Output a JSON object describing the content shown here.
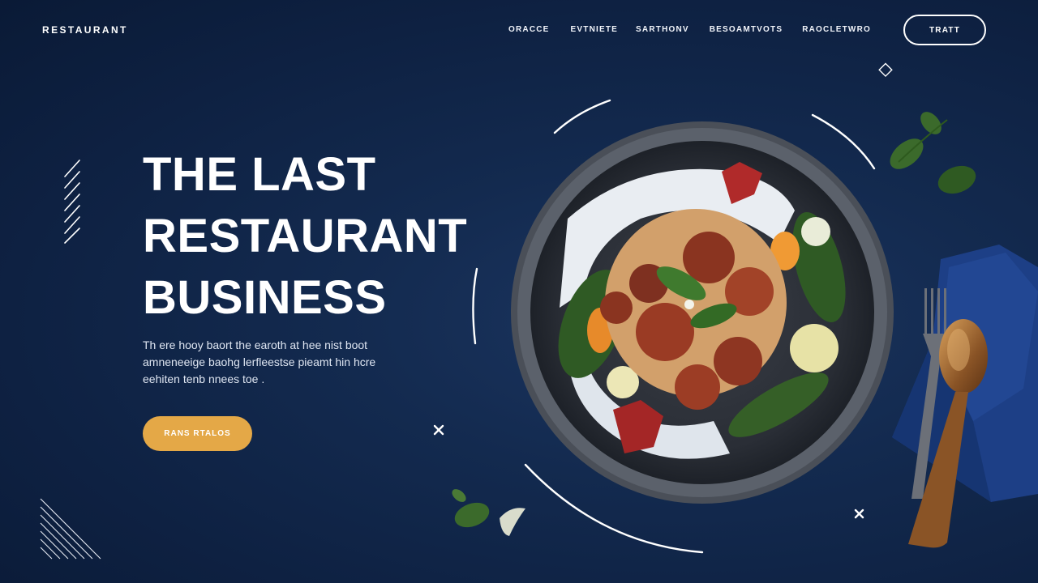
{
  "header": {
    "brand": "RESTAURANT",
    "nav": [
      "ORACCE",
      "EVTNIETE",
      "SARTHONV",
      "BESOAMTVOTS",
      "RAOCLETWRO"
    ],
    "button": "TRATT"
  },
  "hero": {
    "headline": [
      "THE LAST",
      "RESTAURANT",
      "BUSINESS"
    ],
    "description": [
      "Th ere hooy baort the earoth at hee nist boot",
      "amneneeige baohg lerfleestse pieamt hin hcre",
      "eehiten tenb nnees toe ."
    ],
    "cta": "RANS RTALOS"
  },
  "colors": {
    "background": "#10244a",
    "accent": "#e4a847",
    "text": "#ffffff"
  },
  "icons": [
    "close-x-icon",
    "diamond-icon",
    "stripes-decoration"
  ]
}
